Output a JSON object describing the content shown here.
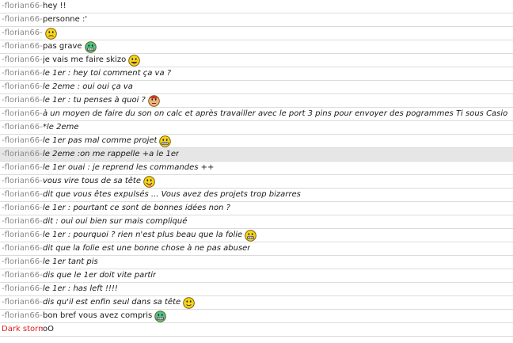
{
  "messages": [
    {
      "nick": "-florian66-",
      "text": "hey !!",
      "italic": false
    },
    {
      "nick": "-florian66-",
      "text": "personne :'",
      "italic": false
    },
    {
      "nick": "-florian66-",
      "text": "",
      "italic": false,
      "icon": "sad-smiley-icon"
    },
    {
      "nick": "-florian66-",
      "text": "pas grave",
      "italic": false,
      "icon": "grin-smiley-icon"
    },
    {
      "nick": "-florian66-",
      "text": "je vais me faire skizo",
      "italic": false,
      "icon": "happy-smiley-icon"
    },
    {
      "nick": "-florian66-",
      "text": "le 1er : hey toi comment ça va ?",
      "italic": true
    },
    {
      "nick": "-florian66-",
      "text": "le 2eme : oui oui ça va",
      "italic": true
    },
    {
      "nick": "-florian66-",
      "text": "le 1er : tu penses à quoi ?",
      "italic": true,
      "icon": "thinking-smiley-icon"
    },
    {
      "nick": "-florian66-",
      "text": "à un moyen de faire du son on calc et après travailler avec le port 3 pins pour envoyer des pogrammes Ti sous Casio",
      "italic": true
    },
    {
      "nick": "-florian66-",
      "text": "*le 2eme",
      "italic": true
    },
    {
      "nick": "-florian66-",
      "text": "le 1er pas mal comme projet",
      "italic": true,
      "icon": "laugh-smiley-icon"
    },
    {
      "nick": "-florian66-",
      "text": "le 2eme :on me rappelle +a le 1er",
      "italic": true,
      "highlight": true
    },
    {
      "nick": "-florian66-",
      "text": "le 1er ouai : je reprend les commandes ++",
      "italic": true
    },
    {
      "nick": "-florian66-",
      "text": " vous vire tous de sa tête",
      "italic": true,
      "icon": "tongue-smiley-icon"
    },
    {
      "nick": "-florian66-",
      "text": "dit que vous êtes expulsés ... Vous avez des projets trop bizarres",
      "italic": true
    },
    {
      "nick": "-florian66-",
      "text": "le 1er : pourtant ce sont de bonnes idées non ?",
      "italic": true
    },
    {
      "nick": "-florian66-",
      "text": "dit : oui oui bien sur mais compliqué",
      "italic": true
    },
    {
      "nick": "-florian66-",
      "text": "le 1er : pourquoi ? rien n'est plus beau que la folie",
      "italic": true,
      "icon": "laugh-smiley-icon"
    },
    {
      "nick": "-florian66-",
      "text": "dit que la folie est une bonne chose à ne pas abuser",
      "italic": true
    },
    {
      "nick": "-florian66-",
      "text": "le 1er tant pis",
      "italic": true
    },
    {
      "nick": "-florian66-",
      "text": "dis que le 1er doit vite partir",
      "italic": true
    },
    {
      "nick": "-florian66-",
      "text": "le 1er : has left !!!!",
      "italic": true
    },
    {
      "nick": "-florian66-",
      "text": "dis qu'il est enfin seul dans sa tête",
      "italic": true,
      "icon": "smile-smiley-icon"
    },
    {
      "nick": "-florian66-",
      "text": "bon bref vous avez compris",
      "italic": false,
      "icon": "grin-smiley-icon"
    },
    {
      "nick": "Dark storm",
      "text": "oO",
      "italic": false,
      "nickColor": "#e01b1b"
    }
  ]
}
